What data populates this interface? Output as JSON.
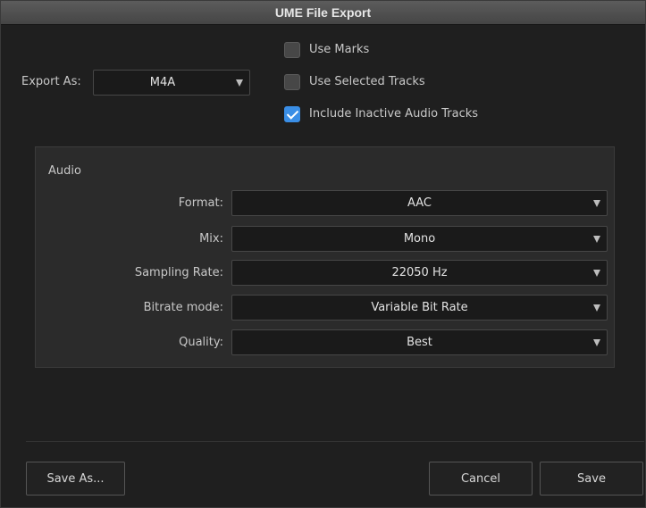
{
  "window": {
    "title": "UME File Export"
  },
  "export": {
    "label": "Export As:",
    "value": "M4A"
  },
  "options": {
    "use_marks": {
      "label": "Use Marks",
      "checked": false
    },
    "use_selected_tracks": {
      "label": "Use Selected Tracks",
      "checked": false
    },
    "include_inactive": {
      "label": "Include Inactive Audio Tracks",
      "checked": true
    }
  },
  "audio": {
    "heading": "Audio",
    "format": {
      "label": "Format:",
      "value": "AAC"
    },
    "mix": {
      "label": "Mix:",
      "value": "Mono"
    },
    "sampling_rate": {
      "label": "Sampling Rate:",
      "value": "22050 Hz"
    },
    "bitrate_mode": {
      "label": "Bitrate mode:",
      "value": "Variable Bit Rate"
    },
    "quality": {
      "label": "Quality:",
      "value": "Best"
    }
  },
  "buttons": {
    "save_as": "Save As...",
    "cancel": "Cancel",
    "save": "Save"
  },
  "colors": {
    "accent": "#3a8ee6",
    "background": "#1f1f1f",
    "panel": "#2b2b2b"
  },
  "icons": {
    "dropdown": "triangle-down-icon",
    "check": "checkmark-icon"
  }
}
